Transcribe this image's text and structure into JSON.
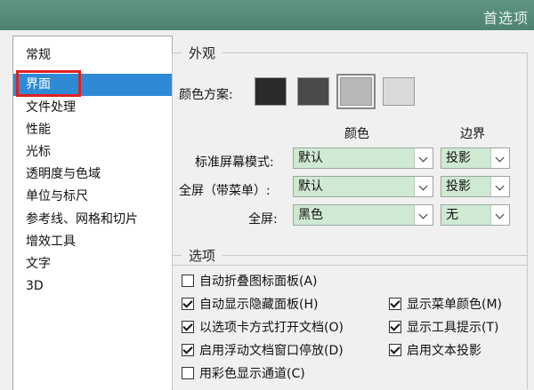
{
  "window": {
    "title": "首选项"
  },
  "sidebar": {
    "items": [
      {
        "label": "常规"
      },
      {
        "label": "界面"
      },
      {
        "label": "文件处理"
      },
      {
        "label": "性能"
      },
      {
        "label": "光标"
      },
      {
        "label": "透明度与色域"
      },
      {
        "label": "单位与标尺"
      },
      {
        "label": "参考线、网格和切片"
      },
      {
        "label": "增效工具"
      },
      {
        "label": "文字"
      },
      {
        "label": "3D"
      }
    ],
    "selected_index": 1
  },
  "appearance": {
    "legend": "外观",
    "color_scheme_label": "颜色方案:",
    "swatches": [
      "#2b2b2b",
      "#4a4a4a",
      "#b8b8b8",
      "#d9d9d9"
    ],
    "selected_swatch_index": 2,
    "col_color": "颜色",
    "col_border": "边界",
    "rows": [
      {
        "label": "标准屏幕模式:",
        "color": "默认",
        "border": "投影"
      },
      {
        "label": "全屏（带菜单）:",
        "color": "默认",
        "border": "投影"
      },
      {
        "label": "全屏:",
        "color": "黑色",
        "border": "无"
      }
    ]
  },
  "options": {
    "legend": "选项",
    "left": [
      {
        "label": "自动折叠图标面板(A)",
        "checked": false
      },
      {
        "label": "自动显示隐藏面板(H)",
        "checked": true
      },
      {
        "label": "以选项卡方式打开文档(O)",
        "checked": true
      },
      {
        "label": "启用浮动文档窗口停放(D)",
        "checked": true
      },
      {
        "label": "用彩色显示通道(C)",
        "checked": false
      }
    ],
    "right": [
      {
        "label": "显示菜单颜色(M)",
        "checked": true
      },
      {
        "label": "显示工具提示(T)",
        "checked": true
      },
      {
        "label": "启用文本投影",
        "checked": true
      }
    ]
  },
  "colors": {
    "titlebar": "#5a8f7c",
    "selection": "#2f8ad6",
    "highlight_box": "#e02020",
    "dropdown_bg": "#cfe9d3"
  }
}
